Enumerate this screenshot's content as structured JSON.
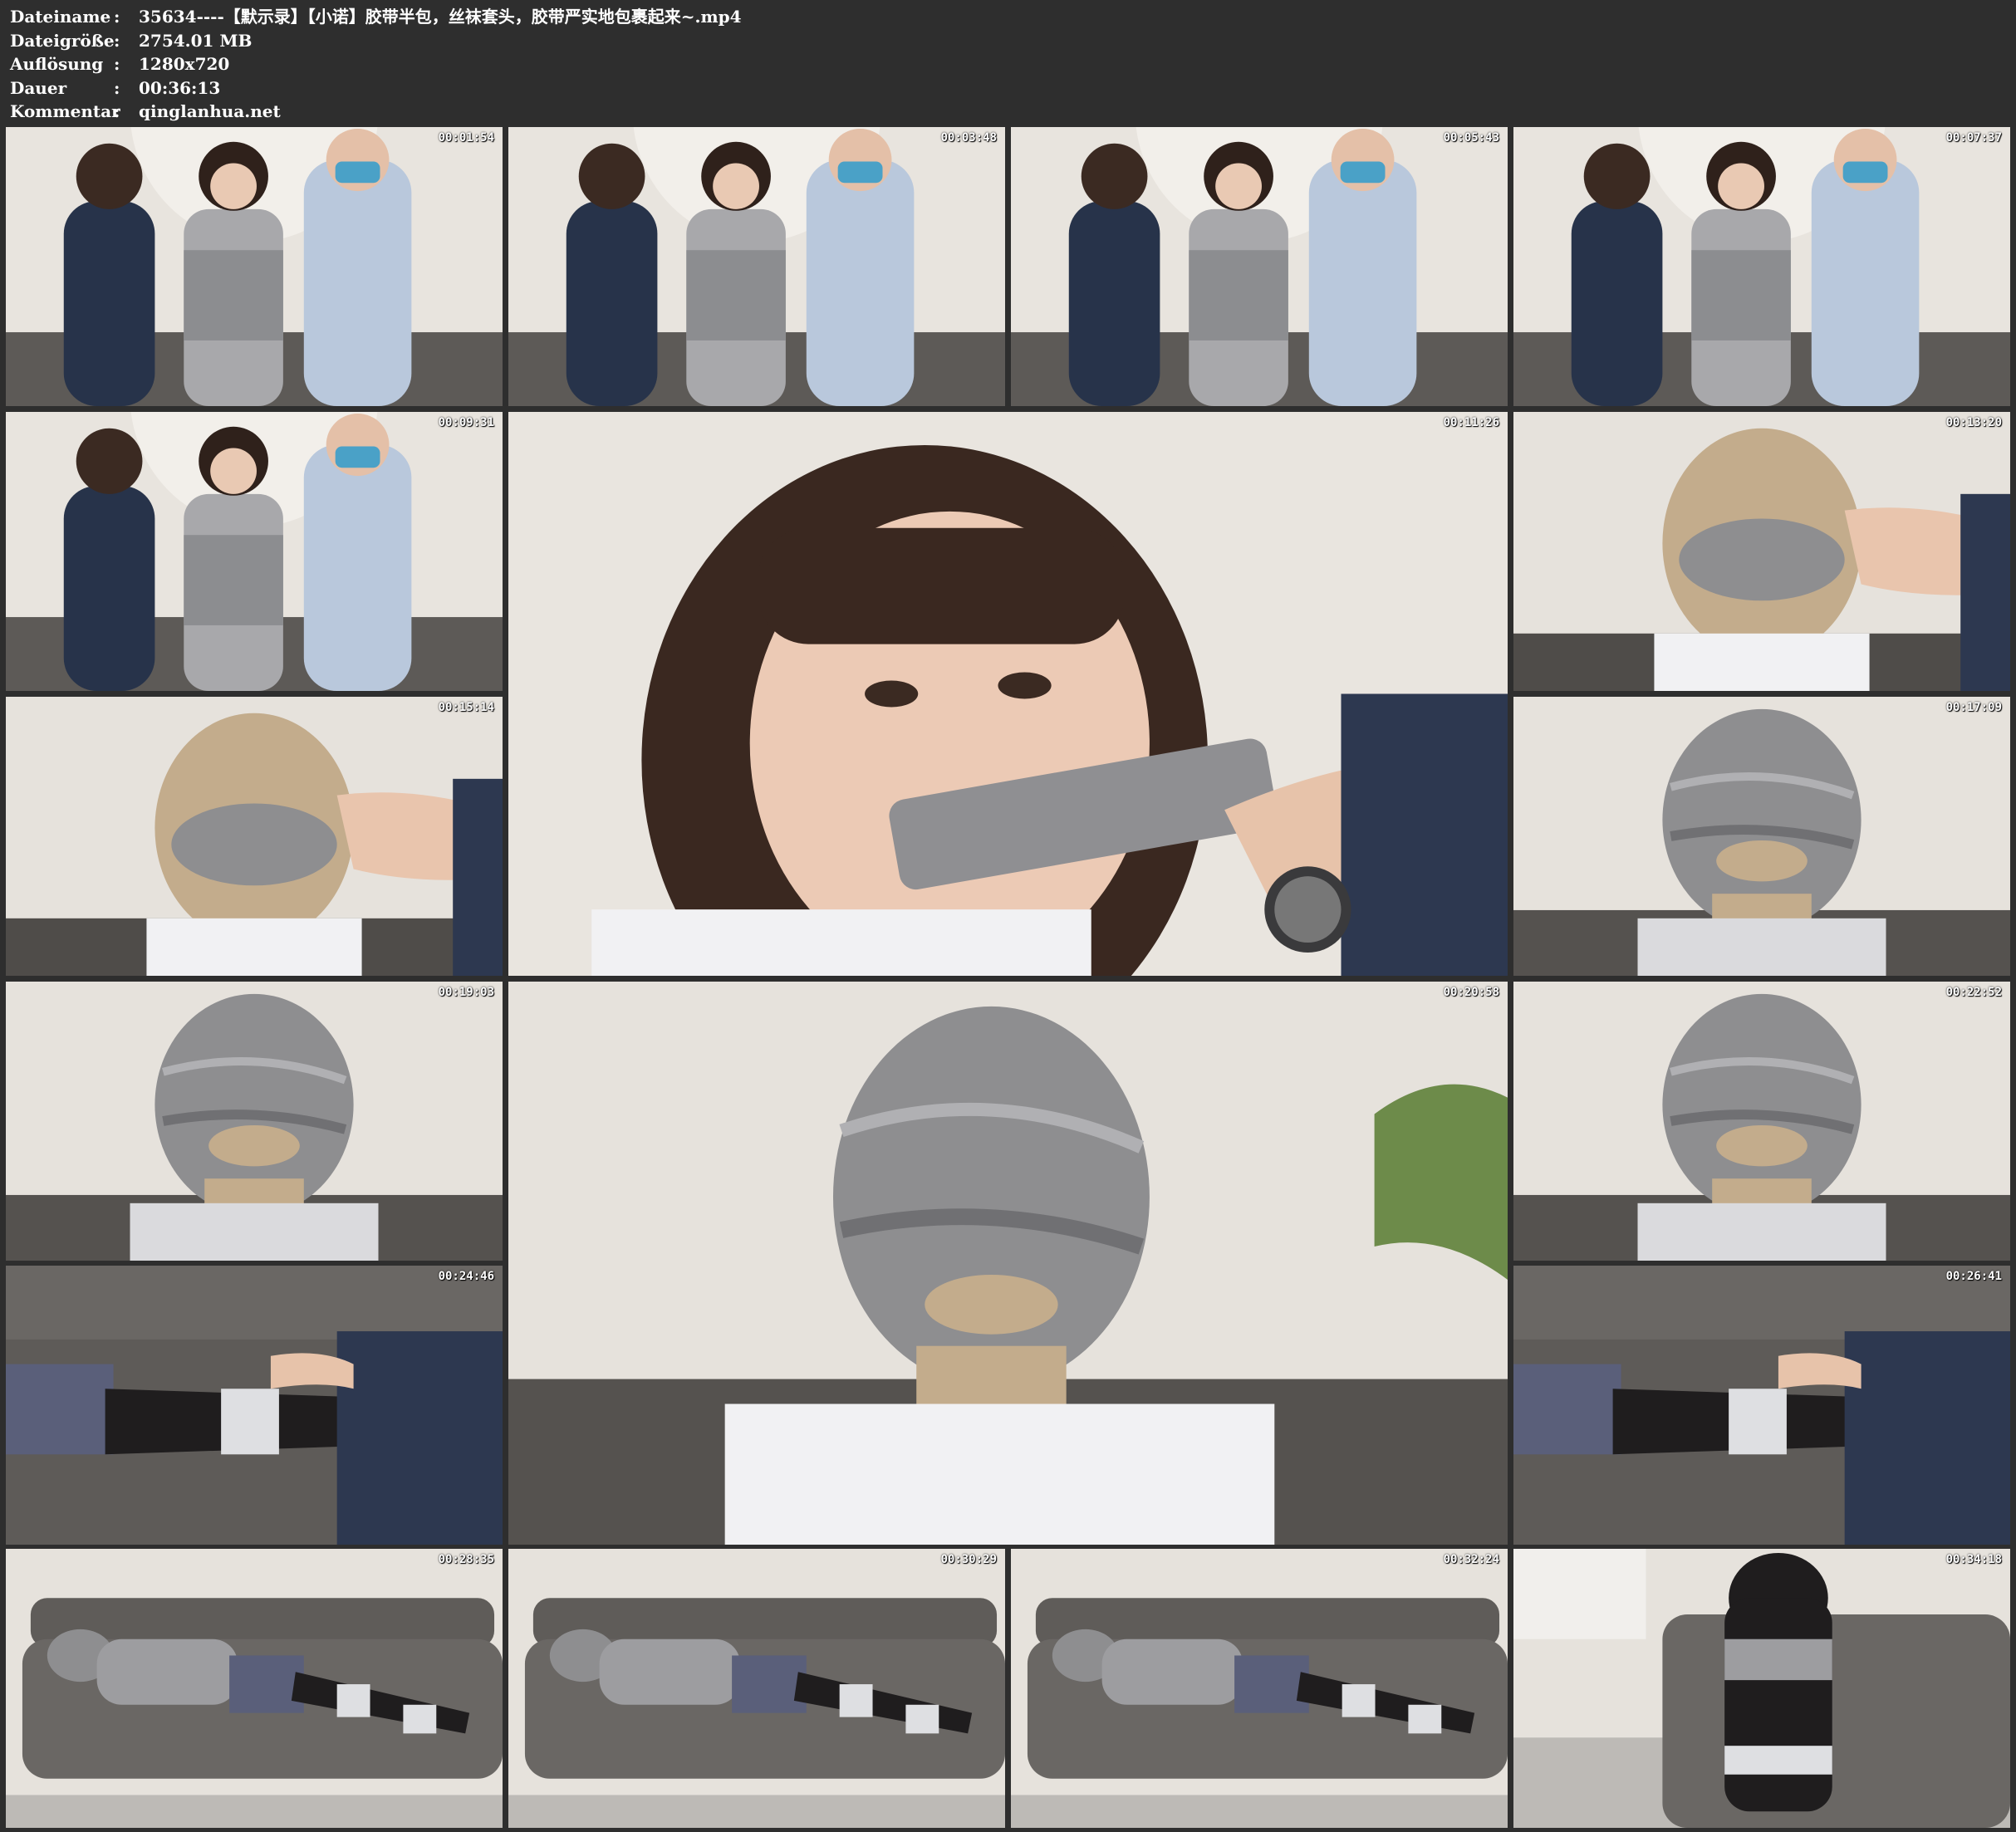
{
  "info": [
    {
      "key": "Dateiname",
      "value": "35634----【默示录】【小诺】胶带半包，丝袜套头，胶带严实地包裹起来~.mp4"
    },
    {
      "key": "Dateigröße",
      "value": "2754.01 MB"
    },
    {
      "key": "Auflösung",
      "value": "1280x720"
    },
    {
      "key": "Dauer",
      "value": "00:36:13"
    },
    {
      "key": "Kommentar",
      "value": "qinglanhua.net"
    }
  ],
  "separator": ":",
  "thumbnails": [
    {
      "time": "00:01:54",
      "scene": "standing-trio"
    },
    {
      "time": "00:03:48",
      "scene": "standing-trio"
    },
    {
      "time": "00:05:43",
      "scene": "standing-trio"
    },
    {
      "time": "00:07:37",
      "scene": "standing-trio"
    },
    {
      "time": "00:09:31",
      "scene": "standing-trio"
    },
    {
      "time": "00:11:26",
      "scene": "closeup-face"
    },
    {
      "time": "00:13:20",
      "scene": "hood"
    },
    {
      "time": "00:15:14",
      "scene": "hood"
    },
    {
      "time": "00:17:09",
      "scene": "hood-taped"
    },
    {
      "time": "00:19:03",
      "scene": "hood-taped"
    },
    {
      "time": "00:20:58",
      "scene": "hood-taped-large"
    },
    {
      "time": "00:22:52",
      "scene": "hood-taped"
    },
    {
      "time": "00:24:46",
      "scene": "legs"
    },
    {
      "time": "00:26:41",
      "scene": "legs"
    },
    {
      "time": "00:28:35",
      "scene": "lying"
    },
    {
      "time": "00:30:29",
      "scene": "lying"
    },
    {
      "time": "00:32:24",
      "scene": "lying"
    },
    {
      "time": "00:34:18",
      "scene": "legs-up"
    }
  ],
  "colors": {
    "background": "#2e2e2e",
    "text": "#ffffff",
    "wall": "#e6e2dc",
    "tape": "#8e8e90",
    "sofa": "#5c5956"
  }
}
